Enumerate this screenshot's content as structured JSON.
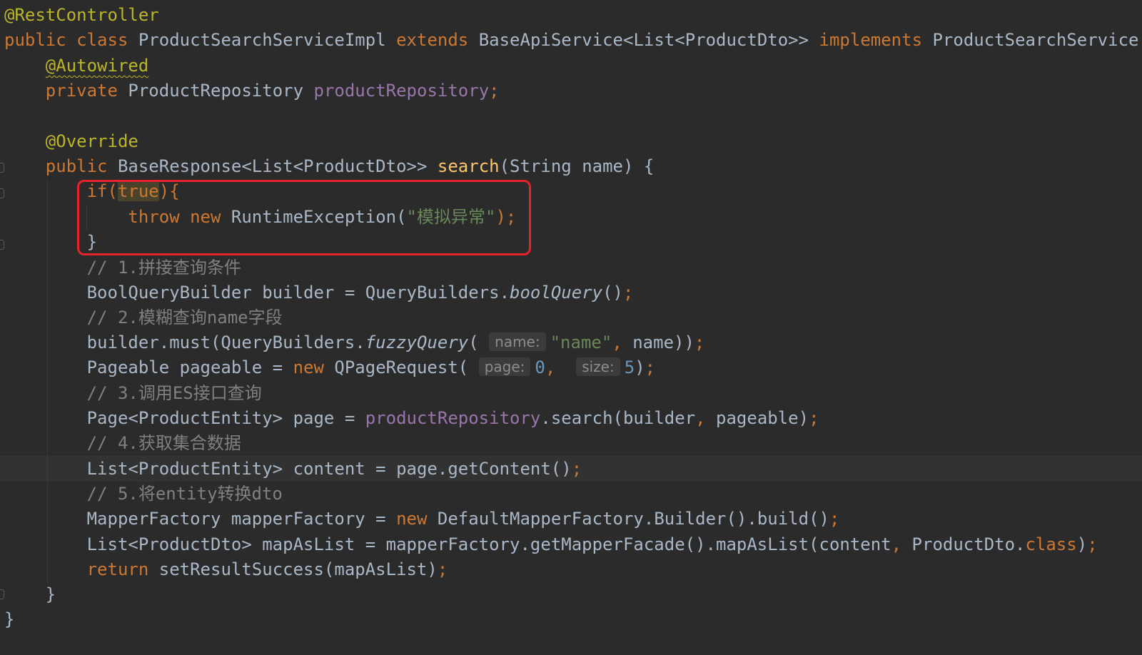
{
  "editor": {
    "theme_colors": {
      "background": "#2b2b2b",
      "keyword": "#cc7832",
      "annotation": "#bbb529",
      "field": "#9876aa",
      "string": "#6a8759",
      "number": "#6897bb",
      "comment": "#808080",
      "method": "#ffc66d",
      "default_text": "#a9b7c6",
      "highlight_box": "#e8222d"
    },
    "t": {
      "rest_controller": "@RestController",
      "public": "public",
      "class": "class",
      "class_name": "ProductSearchServiceImpl",
      "extends": "extends",
      "base_api": "BaseApiService<List<ProductDto>>",
      "implements": "implements",
      "iface": "ProductSearchService {",
      "autowired": "@Autowired",
      "private": "private",
      "repo_type": "ProductRepository",
      "repo_field": "productRepository",
      "semi": ";",
      "override": "@Override",
      "base_resp": "BaseResponse<List<ProductDto>>",
      "search": "search",
      "search_params": "(String name) {",
      "if": "if",
      "lparen": "(",
      "true": "true",
      "rparen_brace": "){",
      "throw": "throw",
      "new": "new",
      "runtime_exc": "RuntimeException(",
      "exc_msg": "\"模拟异常\"",
      "close_semi": ");",
      "brace_close": "}",
      "c1": "// 1.拼接查询条件",
      "bool_decl": "BoolQueryBuilder builder = QueryBuilders.",
      "bool_query": "boolQuery",
      "parens": "()",
      "c2": "// 2.模糊查询name字段",
      "must_call": "builder.must(QueryBuilders.",
      "fuzzy_query": "fuzzyQuery",
      "hint_name": "name:",
      "name_str": "\"name\"",
      "comma": ",",
      "name_arg_close": " name))",
      "pageable_decl": "Pageable pageable = ",
      "qpage": "QPageRequest(",
      "hint_page": "page:",
      "zero": "0",
      "hint_size": "size:",
      "five": "5",
      "rparen": ")",
      "c3": "// 3.调用ES接口查询",
      "page_decl": "Page<ProductEntity> page = ",
      "search_call": ".search(builder",
      "pageable_close": " pageable)",
      "c4": "// 4.获取集合数据",
      "content_decl": "List<ProductEntity> content = page.getContent()",
      "c5": "// 5.将entity转换dto",
      "mf_decl": "MapperFactory mapperFactory = ",
      "dmf_build": "DefaultMapperFactory.Builder().build()",
      "map_decl": "List<ProductDto> mapAsList = mapperFactory.getMapperFacade().mapAsList(content",
      "productdto": " ProductDto.",
      "return": "return",
      "set_result": " setResultSuccess(mapAsList)"
    }
  }
}
